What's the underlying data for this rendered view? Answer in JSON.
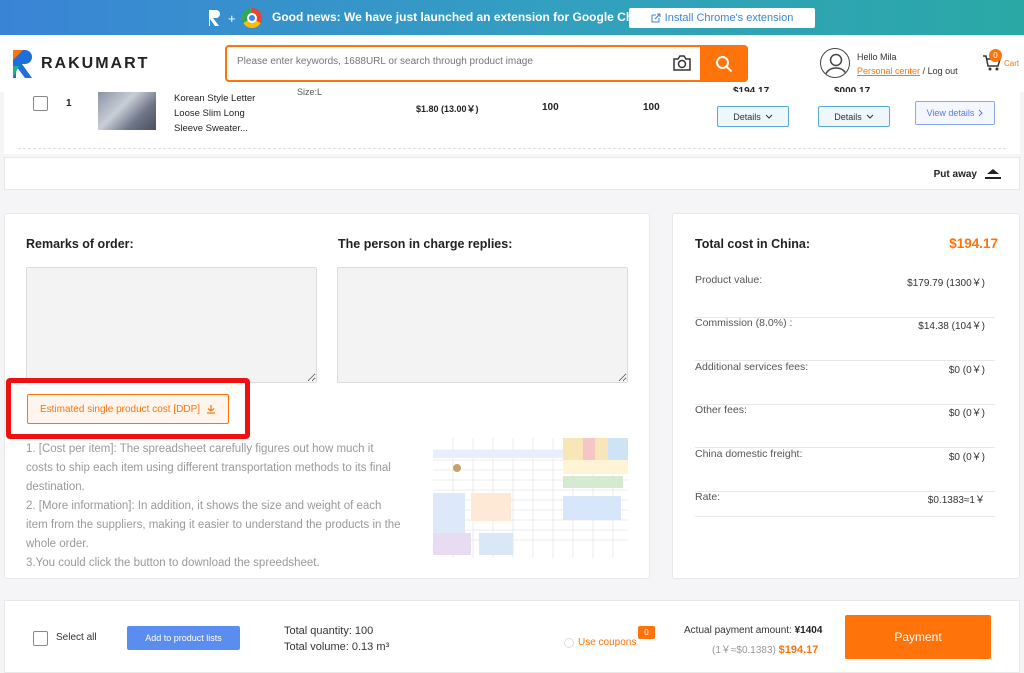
{
  "banner": {
    "message": "Good news: We have just launched an extension for Google Chrome 🎉",
    "install_label": "Install Chrome's extension"
  },
  "header": {
    "logo_text": "RAKUMART",
    "search_placeholder": "Please enter keywords, 1688URL or search through product image",
    "hello": "Hello Mila",
    "personal_center": "Personal center",
    "log_out": "/ Log out",
    "cart_count": "0",
    "cart_label": "Cart"
  },
  "product_row": {
    "index": "1",
    "name_lines": [
      "Korean Style Letter",
      "Loose Slim Long",
      "Sleeve Sweater..."
    ],
    "size": "Size:L",
    "price": "$1.80  (13.00￥)",
    "quantity": "100",
    "quantity2": "100",
    "details_label": "Details",
    "details_label2": "Details",
    "view_details": "View details",
    "cut_value1": "$194.17",
    "cut_value2": "$000.17"
  },
  "put_away": "Put away",
  "remarks": {
    "title": "Remarks of order:",
    "reply_title": "The person in charge replies:",
    "ddp_button": "Estimated single product cost [DDP]",
    "paragraph_lines": [
      "1. [Cost per item]: The spreadsheet carefully figures out how much it",
      "costs to ship each item using different transportation methods to its final",
      "destination.",
      "2. [More information]: In addition, it shows the size and weight of each",
      "item from the suppliers, making it easier to understand the products in the",
      "whole order.",
      "3.You could click the button to download the spreedsheet."
    ]
  },
  "summary": {
    "title": "Total cost in China:",
    "total": "$194.17",
    "rows": [
      {
        "label": "Product value:",
        "value": "$179.79   (1300￥)"
      },
      {
        "label": "Commission  (8.0%) :",
        "value": "$14.38   (104￥)"
      },
      {
        "label": "Additional services fees:",
        "value": "$0   (0￥)"
      },
      {
        "label": "Other fees:",
        "value": "$0   (0￥)"
      },
      {
        "label": "China domestic freight:",
        "value": "$0   (0￥)"
      },
      {
        "label": "Rate:",
        "value": "$0.1383≈1￥"
      }
    ]
  },
  "footer": {
    "select_all": "Select all",
    "add_to_lists": "Add to product lists",
    "total_quantity": "Total quantity:  100",
    "total_volume": "Total volume:  0.13 m³",
    "use_coupons": "Use coupons",
    "coupon_count": "0",
    "actual_label": "Actual payment amount: ",
    "actual_value": "¥1404",
    "rate_text": "(1￥≈$0.1383)",
    "rate_usd": "$194.17",
    "payment": "Payment"
  },
  "colors": {
    "accent": "#ff730b",
    "highlight": "#ee1111",
    "blue_button": "#5b8cf0"
  }
}
